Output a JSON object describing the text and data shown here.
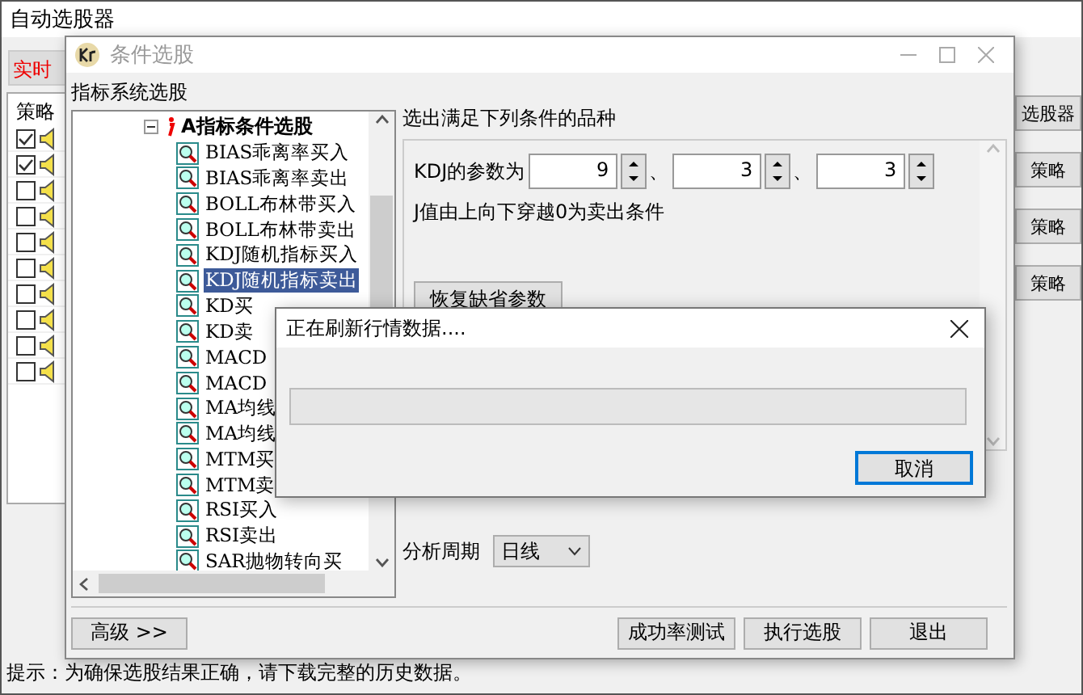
{
  "main_window": {
    "title": "自动选股器",
    "tab": "实时",
    "list_header": "策略",
    "rows": [
      {
        "checked": true
      },
      {
        "checked": true
      },
      {
        "checked": false
      },
      {
        "checked": false
      },
      {
        "checked": false
      },
      {
        "checked": false
      },
      {
        "checked": false
      },
      {
        "checked": false
      },
      {
        "checked": false
      },
      {
        "checked": false
      }
    ],
    "side_buttons": [
      "选股器",
      "策略",
      "策略",
      "策略"
    ],
    "hint": "提示：为确保选股结果正确，请下载完整的历史数据。"
  },
  "dialog": {
    "title": "条件选股",
    "tree_label": "指标系统选股",
    "tree": {
      "label": "A指标条件选股",
      "expanded": true,
      "children": [
        {
          "label": "BIAS乖离率买入",
          "selected": false
        },
        {
          "label": "BIAS乖离率卖出",
          "selected": false
        },
        {
          "label": "BOLL布林带买入",
          "selected": false
        },
        {
          "label": "BOLL布林带卖出",
          "selected": false
        },
        {
          "label": "KDJ随机指标买入",
          "selected": false
        },
        {
          "label": "KDJ随机指标卖出",
          "selected": true
        },
        {
          "label": "KD买",
          "selected": false
        },
        {
          "label": "KD卖",
          "selected": false
        },
        {
          "label": "MACD",
          "selected": false
        },
        {
          "label": "MACD",
          "selected": false
        },
        {
          "label": "MA均线",
          "selected": false
        },
        {
          "label": "MA均线",
          "selected": false
        },
        {
          "label": "MTM买",
          "selected": false
        },
        {
          "label": "MTM卖",
          "selected": false
        },
        {
          "label": "RSI买入",
          "selected": false
        },
        {
          "label": "RSI卖出",
          "selected": false
        },
        {
          "label": "SAR抛物转向买",
          "selected": false
        }
      ]
    },
    "condition_title": "选出满足下列条件的品种",
    "param_label": "KDJ的参数为",
    "params": [
      "9",
      "3",
      "3"
    ],
    "separator": "、",
    "description": "J值由上向下穿越0为卖出条件",
    "reset_button": "恢复缺省参数",
    "period_label": "分析周期",
    "period_value": "日线",
    "advanced_button": "高级 >>",
    "buttons": [
      "成功率测试",
      "执行选股",
      "退出"
    ]
  },
  "progress_dialog": {
    "title": "正在刷新行情数据....",
    "level": 0,
    "cancel_button": "取消"
  }
}
